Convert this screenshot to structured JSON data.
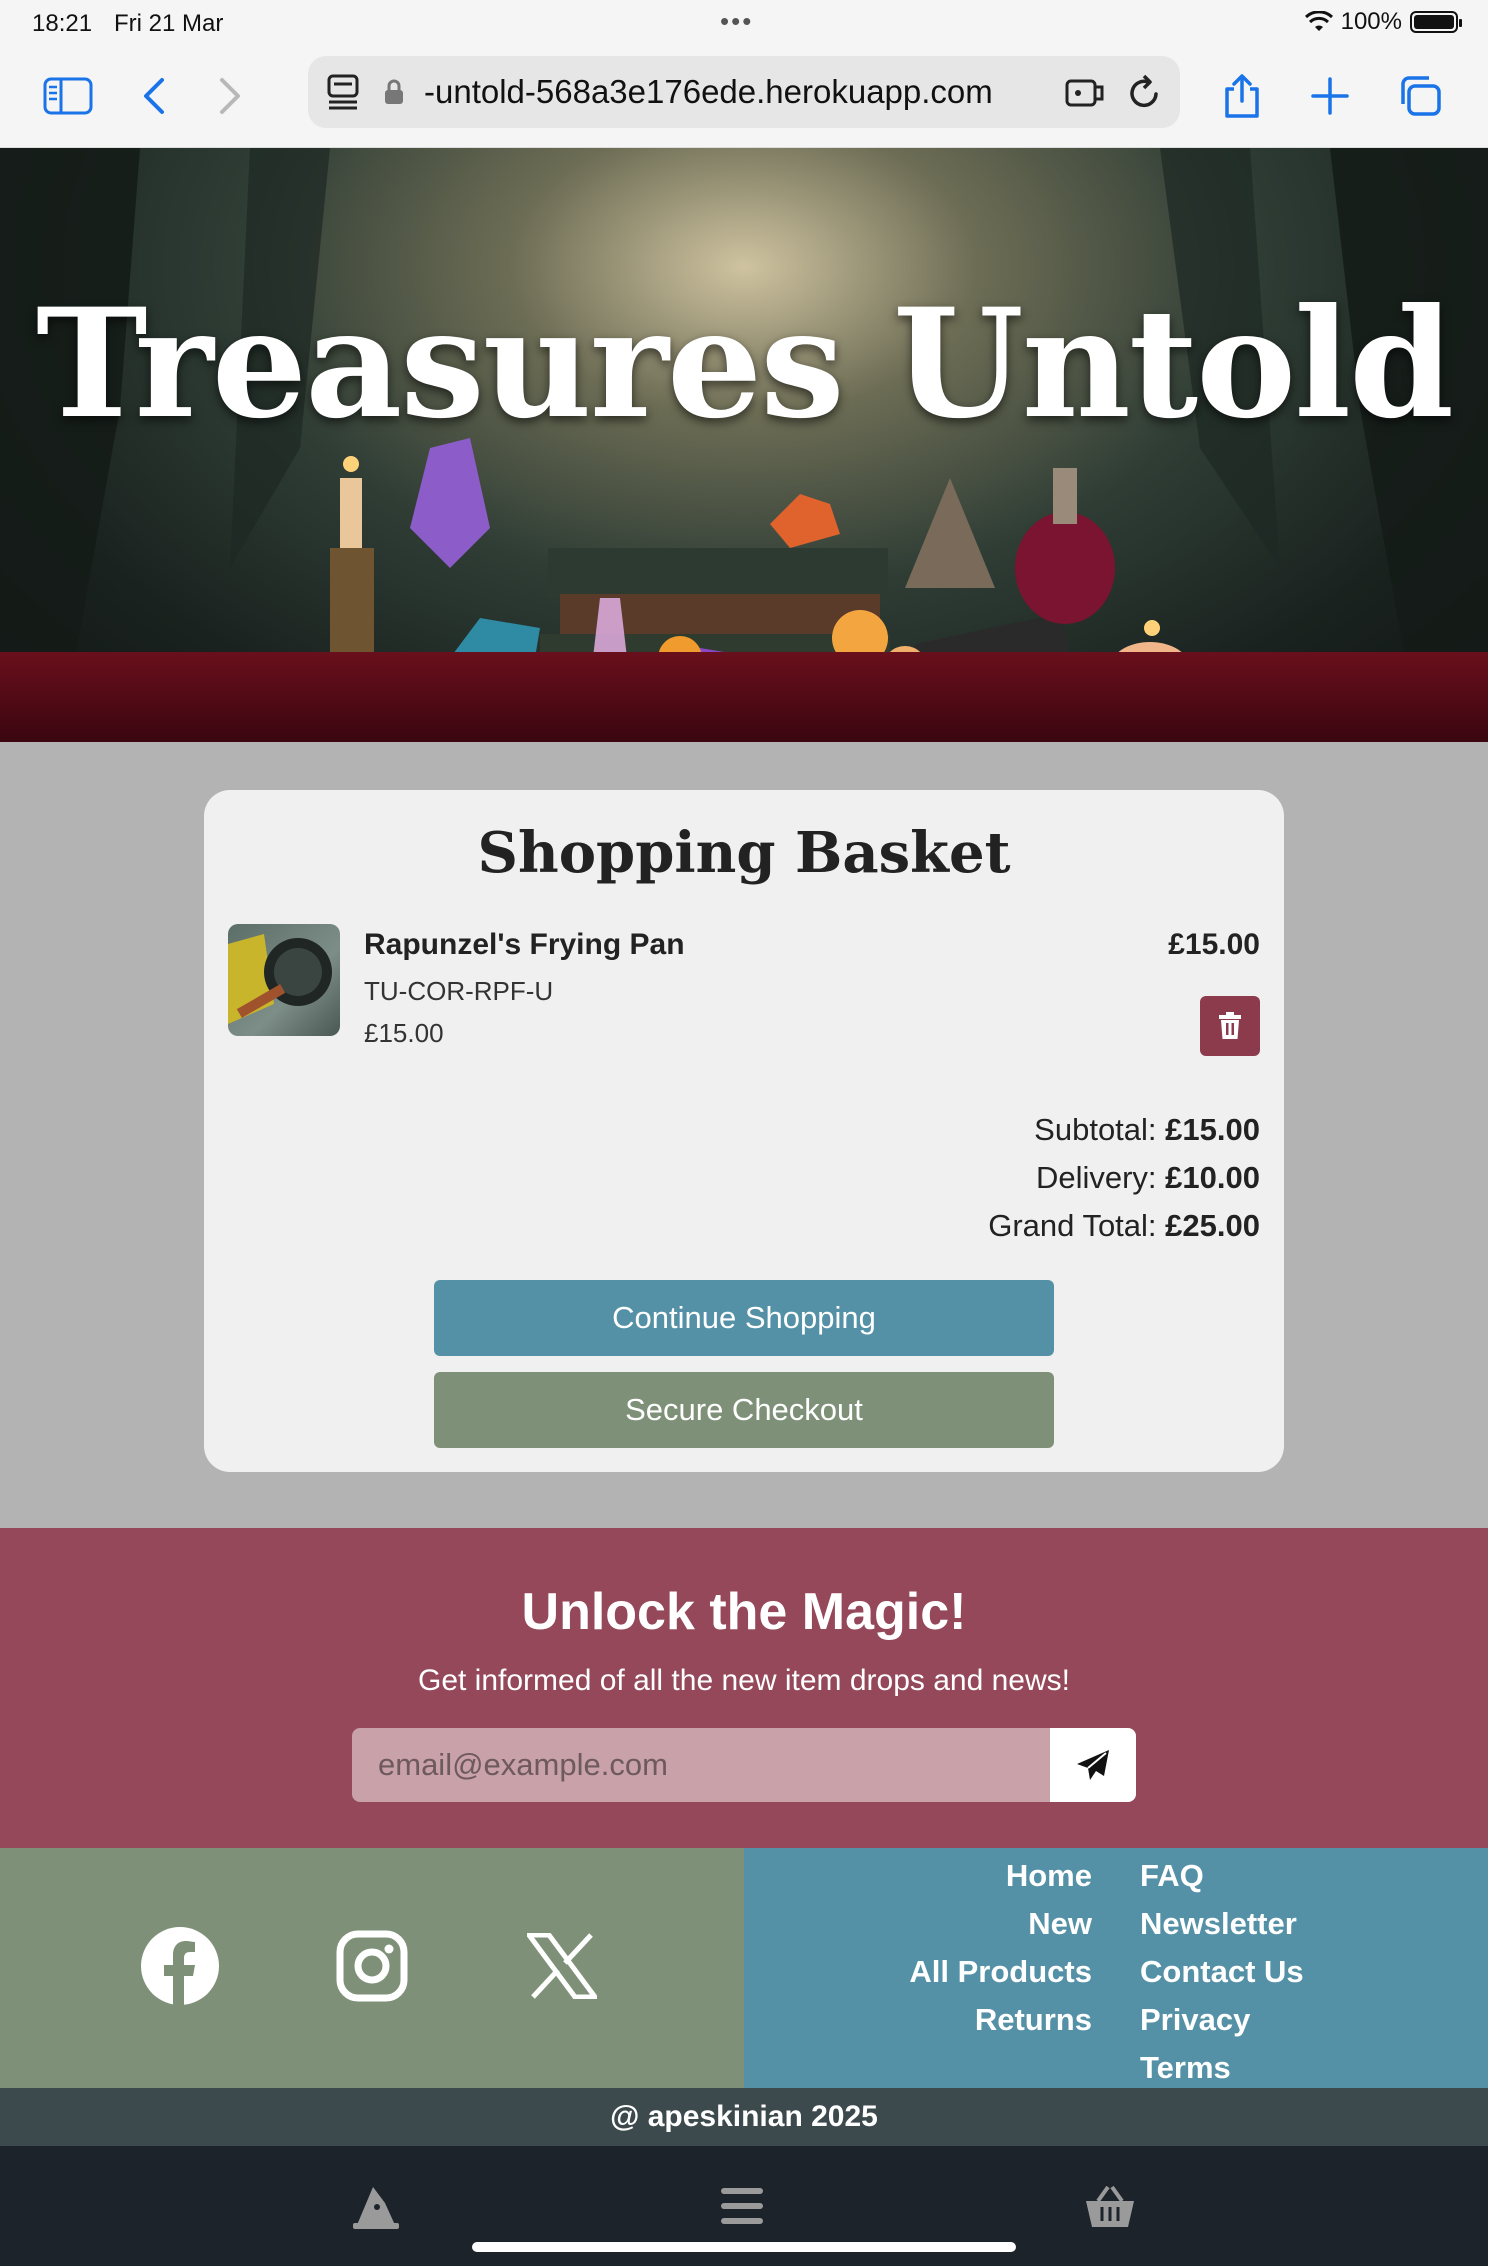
{
  "status_bar": {
    "time": "18:21",
    "date": "Fri 21 Mar",
    "battery": "100%"
  },
  "browser": {
    "url": "-untold-568a3e176ede.herokuapp.com",
    "icons": [
      "sidebar-icon",
      "back-icon",
      "forward-icon",
      "reader-icon",
      "lock-icon",
      "extension-icon",
      "reload-icon",
      "share-icon",
      "new-tab-icon",
      "tabs-icon"
    ]
  },
  "hero": {
    "title": "Treasures Untold"
  },
  "basket": {
    "title": "Shopping Basket",
    "item": {
      "name": "Rapunzel's Frying Pan",
      "sku": "TU-COR-RPF-U",
      "price": "£15.00",
      "line_total": "£15.00"
    },
    "subtotal_label": "Subtotal:",
    "subtotal": "£15.00",
    "delivery_label": "Delivery:",
    "delivery": "£10.00",
    "grand_total_label": "Grand Total:",
    "grand_total": "£25.00",
    "continue_label": "Continue Shopping",
    "checkout_label": "Secure Checkout"
  },
  "newsletter": {
    "title": "Unlock the Magic!",
    "subtitle": "Get informed of all the new item drops and news!",
    "placeholder": "email@example.com"
  },
  "footer": {
    "social": [
      "facebook-icon",
      "instagram-icon",
      "x-icon"
    ],
    "links_left": [
      "Home",
      "New",
      "All Products",
      "Returns"
    ],
    "links_right": [
      "FAQ",
      "Newsletter",
      "Contact Us",
      "Privacy",
      "Terms"
    ],
    "copyright": "@ apeskinian 2025"
  },
  "bottom_nav": [
    "wizard-hat-icon",
    "menu-icon",
    "basket-icon"
  ],
  "colors": {
    "maroon": "#94485a",
    "sage": "#7e9178",
    "teal": "#5591a6",
    "delete": "#8c3b4d",
    "copyright_bg": "#3c4a4d",
    "nav_bg": "#1c232b"
  }
}
